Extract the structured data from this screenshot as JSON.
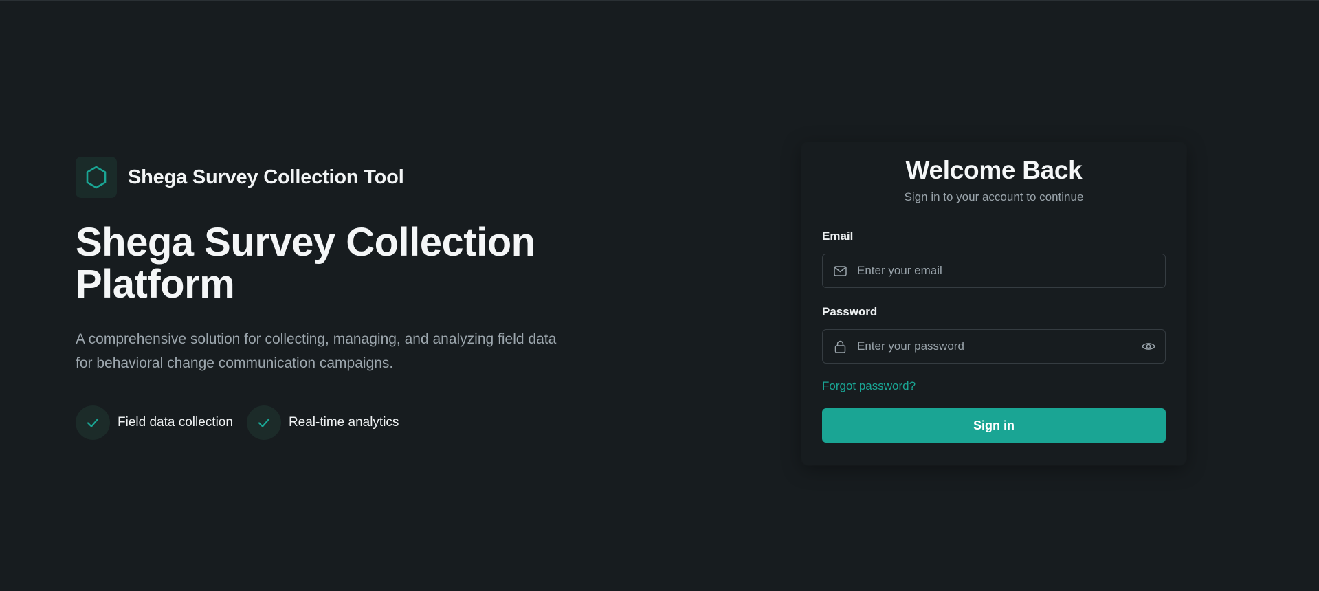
{
  "brand": {
    "logo_icon": "hexagon-icon",
    "name": "Shega Survey Collection Tool"
  },
  "hero": {
    "title_line1": "Shega Survey Collection",
    "title_line2": "Platform",
    "description": "A comprehensive solution for collecting, managing, and analyzing field data for behavioral change communication campaigns.",
    "features": [
      {
        "icon": "check-icon",
        "label": "Field data collection"
      },
      {
        "icon": "check-icon",
        "label": "Real-time analytics"
      }
    ]
  },
  "login": {
    "title": "Welcome Back",
    "subtitle": "Sign in to your account to continue",
    "email": {
      "label": "Email",
      "icon": "mail-icon",
      "placeholder": "Enter your email",
      "value": ""
    },
    "password": {
      "label": "Password",
      "icon": "lock-icon",
      "toggle_icon": "eye-icon",
      "placeholder": "Enter your password",
      "value": ""
    },
    "forgot_label": "Forgot password?",
    "submit_label": "Sign in"
  },
  "colors": {
    "background": "#171c1f",
    "accent": "#1aa594",
    "muted_text": "#9ca6ad",
    "border": "#353c41"
  }
}
